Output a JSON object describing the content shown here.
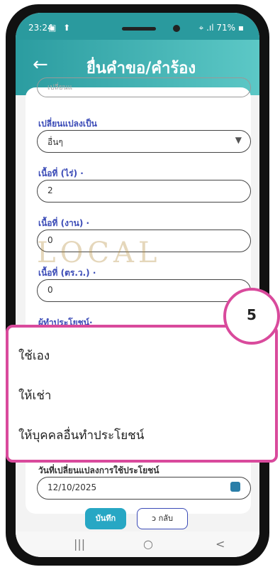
{
  "status": {
    "time": "23:24",
    "icons": "▣ ⬆",
    "right": "⌖ .ıl 71% ▪"
  },
  "header": {
    "back": "←",
    "title": "ยื่นคำขอ/คำร้อง"
  },
  "form": {
    "partial_value": "เปลี่ยนแ",
    "change_to_label": "เปลี่ยนแปลงเป็น",
    "change_to_value": "อื่นๆ",
    "area_rai_label": "เนื้อที่ (ไร่) ·",
    "area_rai_value": "2",
    "area_ngan_label": "เนื้อที่ (งาน) ·",
    "area_ngan_value": "0",
    "area_wa_label": "เนื้อที่ (ตร.ว.) ·",
    "area_wa_value": "0",
    "beneficiary_label": "ผู้ทำประโยชน์·",
    "date_label": "วันที่เปลี่ยนแปลงการใช้ประโยชน์",
    "date_value": "12/10/2025"
  },
  "dropdown": {
    "options": [
      "ใช้เอง",
      "ให้เช่า",
      "ให้บุคคลอื่นทำประโยชน์"
    ]
  },
  "watermark_text": "LOCAL",
  "badge": "5",
  "buttons": {
    "save": "บันทึก",
    "back": "ↄ กลับ"
  },
  "navbar": {
    "recent": "|||",
    "home": "○",
    "back": "<"
  }
}
